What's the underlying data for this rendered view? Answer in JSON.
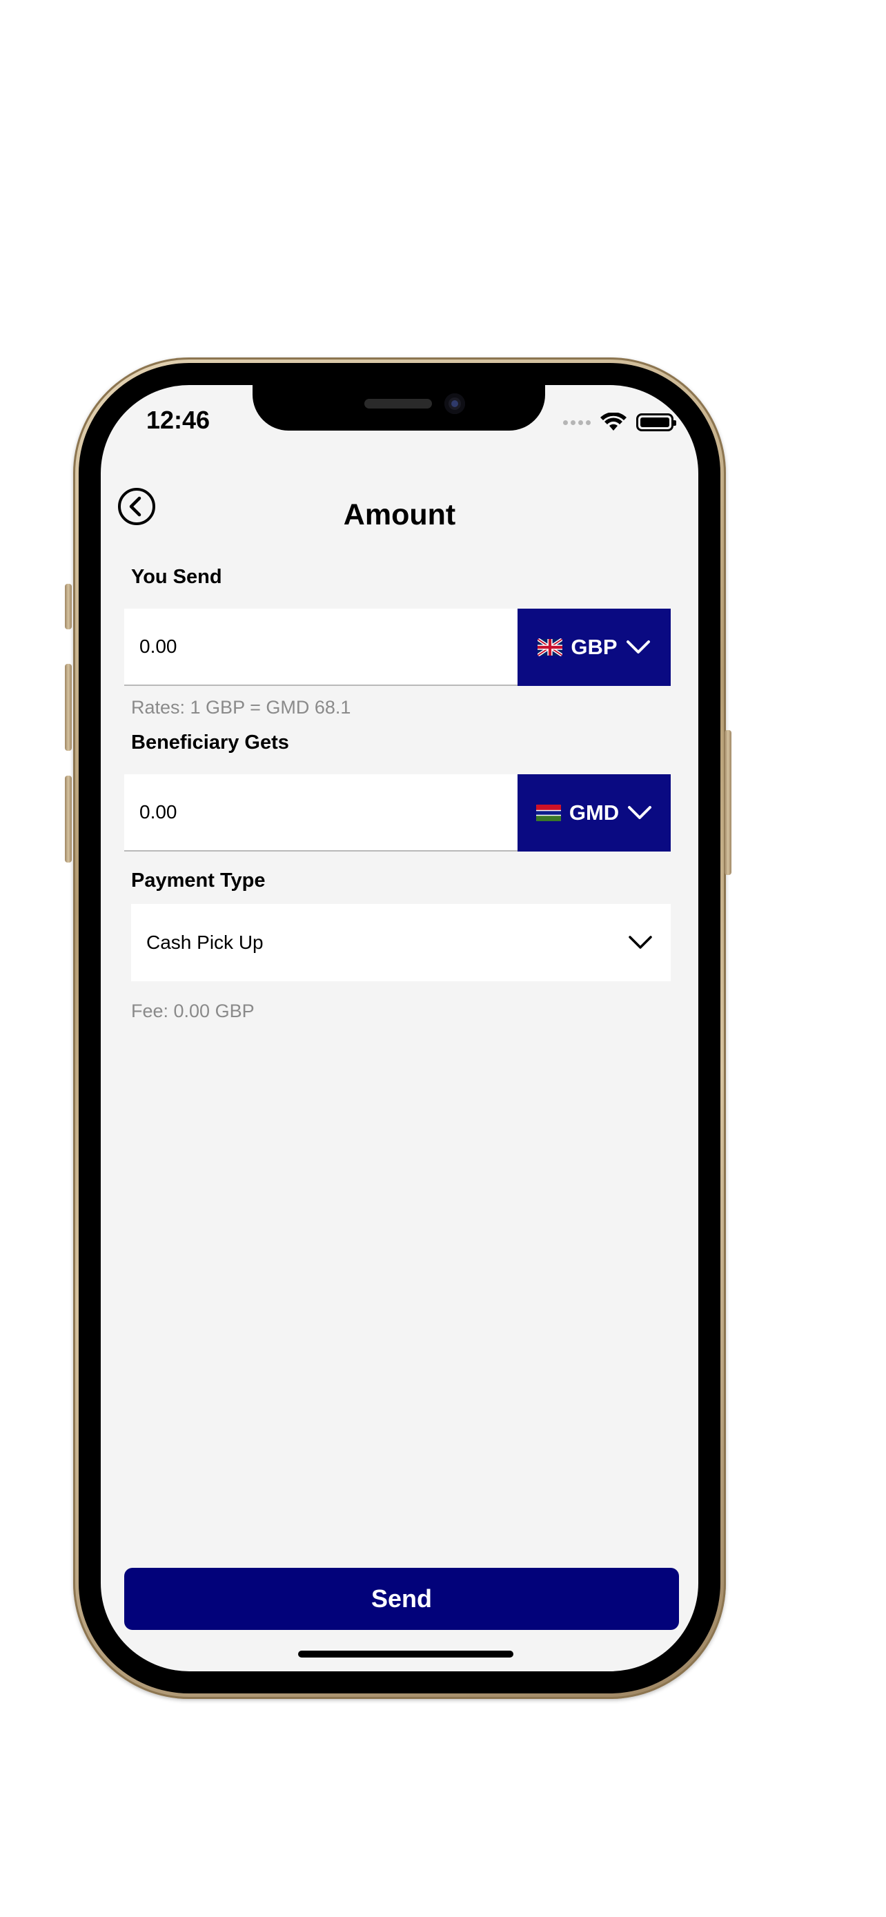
{
  "status_bar": {
    "time": "12:46"
  },
  "header": {
    "title": "Amount"
  },
  "you_send": {
    "label": "You Send",
    "amount": "0.00",
    "currency": "GBP"
  },
  "rate_text": "Rates: 1 GBP = GMD 68.1",
  "beneficiary_gets": {
    "label": "Beneficiary Gets",
    "amount": "0.00",
    "currency": "GMD"
  },
  "payment_type": {
    "label": "Payment Type",
    "selected": "Cash Pick Up"
  },
  "fee_text": "Fee: 0.00 GBP",
  "actions": {
    "send_label": "Send"
  },
  "colors": {
    "primary": "#02027a",
    "currency_bg": "#0a0a82",
    "screen_bg": "#f4f4f4",
    "muted_text": "#8a8a8a"
  }
}
